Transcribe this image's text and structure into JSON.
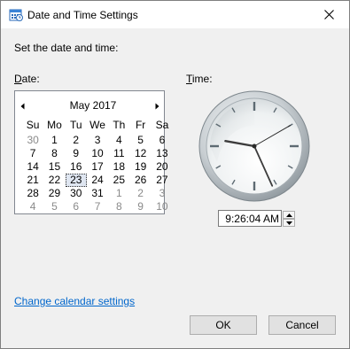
{
  "window": {
    "title": "Date and Time Settings"
  },
  "instruction": "Set the date and time:",
  "date_label": {
    "accel": "D",
    "rest": "ate:"
  },
  "time_label": {
    "accel": "T",
    "rest": "ime:"
  },
  "calendar": {
    "month_label": "May 2017",
    "weekdays": [
      "Su",
      "Mo",
      "Tu",
      "We",
      "Th",
      "Fr",
      "Sa"
    ],
    "weeks": [
      [
        "30",
        "1",
        "2",
        "3",
        "4",
        "5",
        "6"
      ],
      [
        "7",
        "8",
        "9",
        "10",
        "11",
        "12",
        "13"
      ],
      [
        "14",
        "15",
        "16",
        "17",
        "18",
        "19",
        "20"
      ],
      [
        "21",
        "22",
        "23",
        "24",
        "25",
        "26",
        "27"
      ],
      [
        "28",
        "29",
        "30",
        "31",
        "1",
        "2",
        "3"
      ],
      [
        "4",
        "5",
        "6",
        "7",
        "8",
        "9",
        "10"
      ]
    ],
    "selected_day": "23"
  },
  "time": {
    "value": "9:26:04 AM"
  },
  "link_text": "Change calendar settings",
  "buttons": {
    "ok": "OK",
    "cancel": "Cancel"
  },
  "icons": {
    "app": "calendar-clock-icon",
    "close": "close-icon",
    "prev": "chevron-left-icon",
    "next": "chevron-right-icon",
    "spin_up": "spin-up-icon",
    "spin_down": "spin-down-icon"
  },
  "colors": {
    "link": "#0066cc",
    "clock_hand_second": "#2a2a2a"
  }
}
